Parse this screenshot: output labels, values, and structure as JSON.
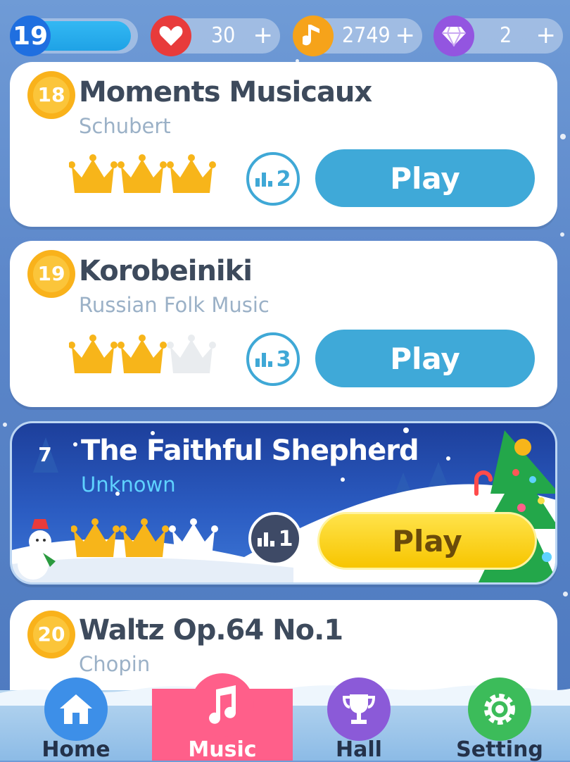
{
  "topbar": {
    "level": "19",
    "hearts": "30",
    "notes": "2749",
    "gems": "2",
    "plus": "+"
  },
  "songs": [
    {
      "badge": "18",
      "title": "Moments Musicaux",
      "artist": "Schubert",
      "crowns_earned": 3,
      "crowns_total": 3,
      "rank": "2",
      "play_label": "Play"
    },
    {
      "badge": "19",
      "title": "Korobeiniki",
      "artist": "Russian Folk Music",
      "crowns_earned": 2,
      "crowns_total": 3,
      "rank": "3",
      "play_label": "Play"
    },
    {
      "badge": "7",
      "title": "The Faithful Shepherd",
      "artist": "Unknown",
      "crowns_earned": 2,
      "crowns_total": 3,
      "rank": "1",
      "play_label": "Play",
      "special": true
    },
    {
      "badge": "20",
      "title": "Waltz Op.64 No.1",
      "artist": "Chopin"
    }
  ],
  "nav": [
    {
      "label": "Home",
      "icon": "home-icon",
      "color": "#3d8fe8"
    },
    {
      "label": "Music",
      "icon": "music-note-icon",
      "color": "#ff5f8a",
      "active": true
    },
    {
      "label": "Hall",
      "icon": "trophy-icon",
      "color": "#8b5ad8"
    },
    {
      "label": "Setting",
      "icon": "gear-icon",
      "color": "#3cbc5a"
    }
  ],
  "colors": {
    "level_blue": "#1f6fe0",
    "heart_red": "#e83b3b",
    "note_orange": "#f6a31a",
    "gem_purple": "#9355e0",
    "crown_gold": "#f7b51a",
    "play_blue": "#3fa9d8",
    "play_yellow": "#f7c500"
  }
}
